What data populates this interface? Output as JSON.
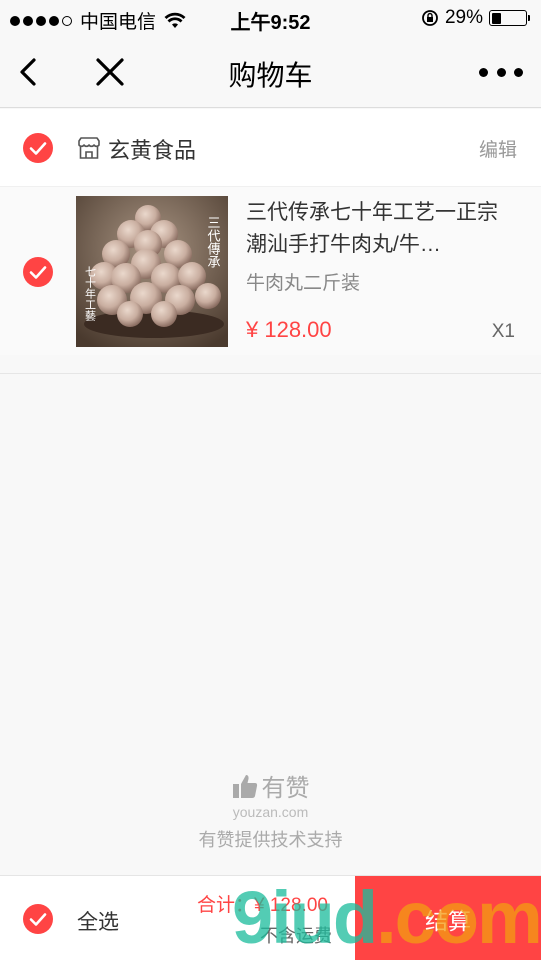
{
  "status_bar": {
    "carrier": "中国电信",
    "time": "上午9:52",
    "battery": "29%",
    "battery_level": 0.29
  },
  "nav": {
    "title": "购物车"
  },
  "store": {
    "name": "玄黄食品",
    "edit_label": "编辑"
  },
  "item": {
    "title": "三代传承七十年工艺一正宗潮汕手打牛肉丸/牛…",
    "spec": "牛肉丸二斤装",
    "price": "¥ 128.00",
    "quantity": "X1",
    "image_text_right": "三代傳承",
    "image_text_left": "七十年工藝"
  },
  "brand": {
    "name": "有赞",
    "domain": "youzan.com",
    "support": "有赞提供技术支持"
  },
  "footer": {
    "select_all": "全选",
    "total": "合计：¥ 128.00",
    "shipping_note": "不含运费",
    "checkout": "结算"
  },
  "watermark": {
    "part1": "9iud",
    "part2": ".com"
  },
  "colors": {
    "accent": "#ff4444",
    "background": "#f8f8f8"
  }
}
